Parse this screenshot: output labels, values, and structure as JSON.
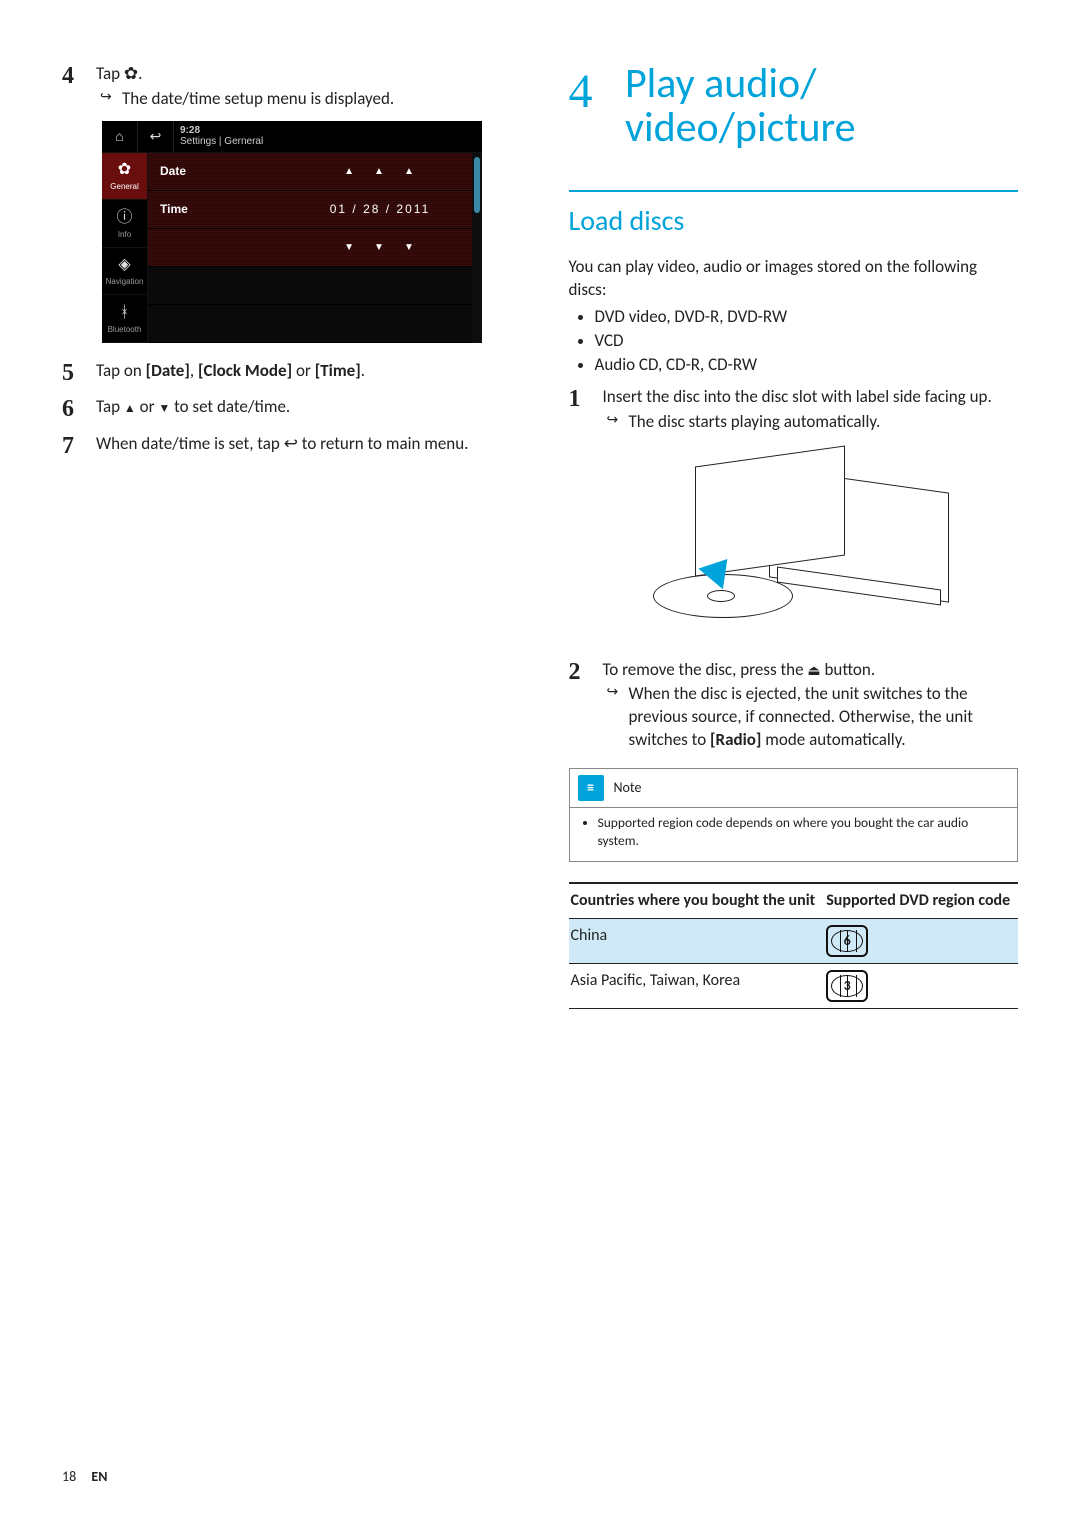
{
  "left": {
    "step4": {
      "num": "4",
      "text": "Tap ",
      "tail": ".",
      "result": "The date/time setup menu is displayed."
    },
    "screen": {
      "time": "9:28",
      "breadcrumb": "Settings | Gerneral",
      "side": {
        "general": "General",
        "info": "Info",
        "navigation": "Navigation",
        "bluetooth": "Bluetooth"
      },
      "rows": {
        "date_label": "Date",
        "time_label": "Time",
        "date_value": "01  /  28  / 2011"
      }
    },
    "step5": {
      "num": "5",
      "pre": "Tap on ",
      "b1": "[Date]",
      "mid1": ", ",
      "b2": "[Clock Mode]",
      "mid2": " or ",
      "b3": "[Time]",
      "tail": "."
    },
    "step6": {
      "num": "6",
      "pre": "Tap ",
      "mid": " or ",
      "tail": " to set date/time."
    },
    "step7": {
      "num": "7",
      "pre": "When date/time is set, tap ",
      "tail": " to return to main menu."
    }
  },
  "right": {
    "chapter_num": "4",
    "chapter_title": "Play audio/ video/picture",
    "section": "Load discs",
    "intro": "You can play video, audio or images stored on the following discs:",
    "bullets": [
      "DVD video, DVD-R, DVD-RW",
      "VCD",
      "Audio CD, CD-R, CD-RW"
    ],
    "s1": {
      "num": "1",
      "text": "Insert the disc into the disc slot with label side facing up.",
      "result": "The disc starts playing automatically."
    },
    "s2": {
      "num": "2",
      "pre": "To remove the disc, press the ",
      "tail": " button.",
      "result_a": "When the disc is ejected, the unit switches to the previous source, if connected. Otherwise, the unit switches to ",
      "result_b": "[Radio]",
      "result_c": " mode automatically."
    },
    "note": {
      "title": "Note",
      "text": "Supported region code depends on where you bought the car audio system."
    },
    "table": {
      "h1": "Countries where you bought the unit",
      "h2": "Supported DVD region code",
      "r1": {
        "country": "China",
        "code": "6"
      },
      "r2": {
        "country": "Asia Pacific, Taiwan, Korea",
        "code": "3"
      }
    }
  },
  "footer": {
    "page": "18",
    "lang": "EN"
  }
}
